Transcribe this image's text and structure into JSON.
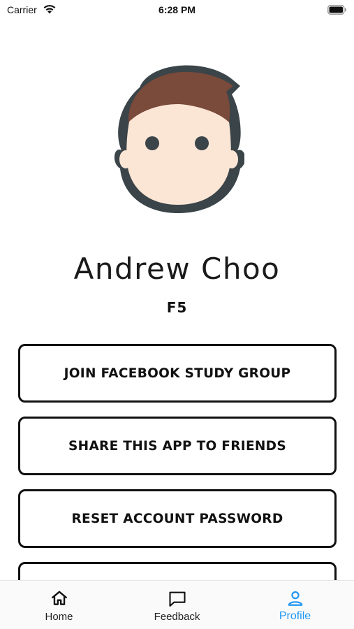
{
  "status_bar": {
    "carrier": "Carrier",
    "time": "6:28 PM"
  },
  "profile": {
    "name": "Andrew Choo",
    "subtitle": "F5"
  },
  "actions": [
    {
      "label": "JOIN FACEBOOK STUDY GROUP"
    },
    {
      "label": "SHARE THIS APP TO FRIENDS"
    },
    {
      "label": "RESET ACCOUNT PASSWORD"
    },
    {
      "label": ""
    }
  ],
  "tabs": [
    {
      "label": "Home",
      "icon": "home-icon",
      "active": false
    },
    {
      "label": "Feedback",
      "icon": "chat-bubble-icon",
      "active": false
    },
    {
      "label": "Profile",
      "icon": "person-icon",
      "active": true
    }
  ],
  "colors": {
    "accent": "#2196f3",
    "hair": "#7a4a3a",
    "skin": "#fbe6d6",
    "outline": "#3a4449"
  }
}
